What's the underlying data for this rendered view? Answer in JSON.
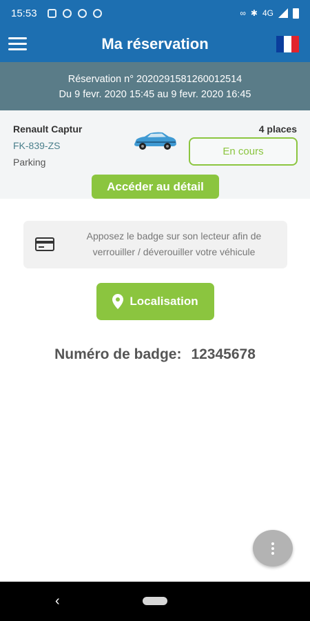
{
  "status_bar": {
    "time": "15:53",
    "network": "4G",
    "icons": [
      "image-icon",
      "phone-icon",
      "settings-icon",
      "phone-icon",
      "link-icon",
      "bluetooth-icon",
      "signal-icon",
      "battery-icon"
    ]
  },
  "header": {
    "title": "Ma réservation",
    "menu_icon": "menu-icon",
    "language_icon": "flag-fr-icon"
  },
  "reservation": {
    "number_line": "Réservation n° 2020291581260012514",
    "period_line": "Du 9 fevr. 2020 15:45 au 9 fevr. 2020 16:45"
  },
  "vehicle": {
    "model": "Renault Captur",
    "plate": "FK-839-ZS",
    "location": "Parking",
    "seats": "4 places",
    "status": "En cours"
  },
  "actions": {
    "detail_label": "Accéder au détail",
    "localisation_label": "Localisation"
  },
  "badge": {
    "info_text": "Apposez le badge sur son lecteur afin de verrouiller / déverouiller votre véhicule",
    "number_label": "Numéro de badge:",
    "number_value": "12345678"
  },
  "colors": {
    "primary": "#1d6fb1",
    "banner": "#5a7c88",
    "accent": "#8bc53f"
  }
}
